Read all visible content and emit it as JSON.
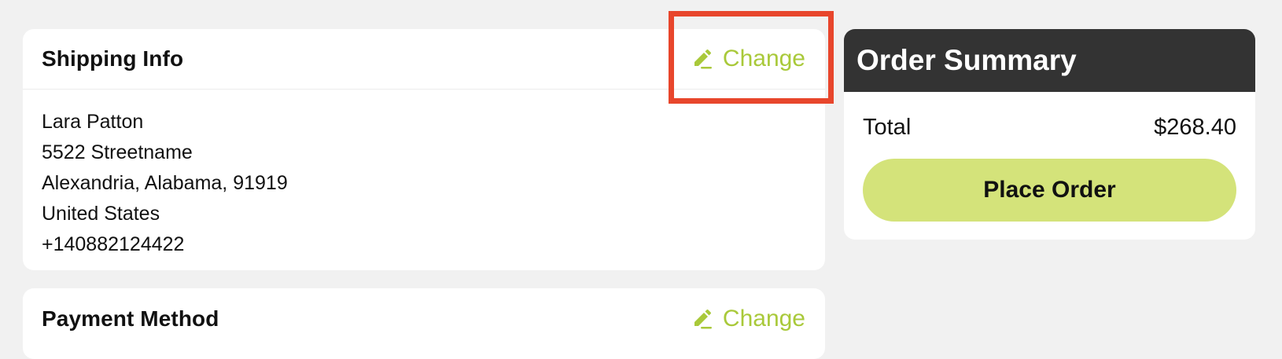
{
  "shipping": {
    "title": "Shipping Info",
    "change_label": "Change",
    "address_lines": [
      "Lara Patton",
      "5522 Streetname",
      "Alexandria, Alabama, 91919",
      "United States",
      "+140882124422"
    ]
  },
  "payment": {
    "title": "Payment Method",
    "change_label": "Change"
  },
  "summary": {
    "title": "Order Summary",
    "total_label": "Total",
    "total_value": "$268.40",
    "place_order_label": "Place Order"
  },
  "colors": {
    "accent": "#a9c93a",
    "button_bg": "#d4e37a",
    "header_bg": "#333333",
    "highlight": "#e8462c"
  },
  "icons": {
    "change": "pencil-icon"
  }
}
